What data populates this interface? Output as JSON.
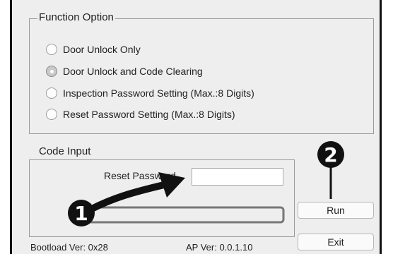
{
  "function_option": {
    "title": "Function Option",
    "options": [
      {
        "label": "Door Unlock Only",
        "checked": false
      },
      {
        "label": "Door Unlock and Code Clearing",
        "checked": true
      },
      {
        "label": "Inspection Password Setting (Max.:8 Digits)",
        "checked": false
      },
      {
        "label": "Reset Password Setting (Max.:8 Digits)",
        "checked": false
      }
    ]
  },
  "code_input": {
    "title": "Code Input",
    "reset_password_label": "Reset Password",
    "reset_password_value": ""
  },
  "buttons": {
    "run": "Run",
    "exit": "Exit"
  },
  "annotations": {
    "step1": "1",
    "step2": "2"
  },
  "footer": {
    "bootload": "Bootload Ver: 0x28",
    "ap": "AP Ver: 0.0.1.10"
  }
}
